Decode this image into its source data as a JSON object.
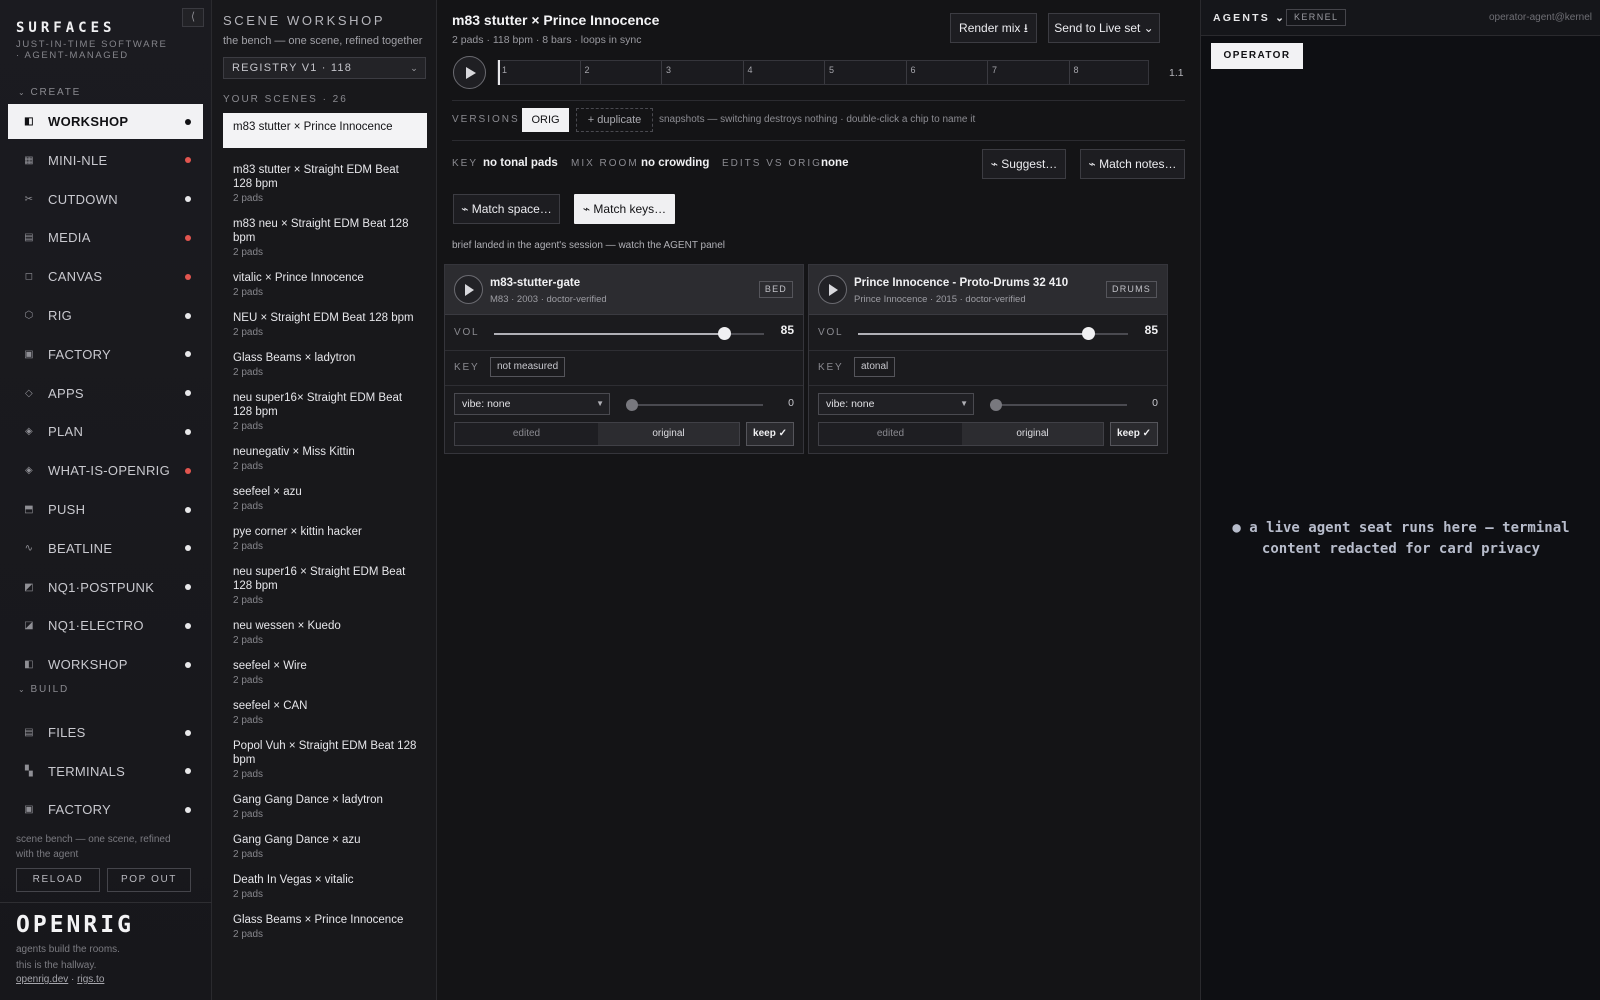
{
  "sidebar": {
    "brand_title": "SURFACES",
    "brand_sub": "JUST-IN-TIME SOFTWARE · AGENT-MANAGED",
    "collapse_glyph": "⟨",
    "create_label": "CREATE",
    "build_label": "BUILD",
    "create_items": [
      {
        "label": "WORKSHOP",
        "icon": "workshop-icon",
        "glyph": "◧",
        "dot": "white",
        "active": true
      },
      {
        "label": "MINI-NLE",
        "icon": "timeline-icon",
        "glyph": "▦",
        "dot": "red"
      },
      {
        "label": "CUTDOWN",
        "icon": "scissors-icon",
        "glyph": "✂",
        "dot": "white"
      },
      {
        "label": "MEDIA",
        "icon": "grid-icon",
        "glyph": "▤",
        "dot": "red"
      },
      {
        "label": "CANVAS",
        "icon": "canvas-icon",
        "glyph": "◻",
        "dot": "red"
      },
      {
        "label": "RIG",
        "icon": "hexagon-icon",
        "glyph": "⬡",
        "dot": "white"
      },
      {
        "label": "FACTORY",
        "icon": "factory-icon",
        "glyph": "▣",
        "dot": "white"
      },
      {
        "label": "APPS",
        "icon": "diamond-icon",
        "glyph": "◇",
        "dot": "white"
      },
      {
        "label": "PLAN",
        "icon": "plan-icon",
        "glyph": "◈",
        "dot": "white"
      },
      {
        "label": "WHAT-IS-OPENRIG",
        "icon": "info-diamond-icon",
        "glyph": "◈",
        "dot": "red"
      },
      {
        "label": "PUSH",
        "icon": "push-icon",
        "glyph": "⬒",
        "dot": "white"
      },
      {
        "label": "BEATLINE",
        "icon": "wave-icon",
        "glyph": "∿",
        "dot": "white"
      },
      {
        "label": "NQ1·POSTPUNK",
        "icon": "postpunk-icon",
        "glyph": "◩",
        "dot": "white"
      },
      {
        "label": "NQ1·ELECTRO",
        "icon": "electro-icon",
        "glyph": "◪",
        "dot": "white"
      },
      {
        "label": "WORKSHOP",
        "icon": "workshop-icon",
        "glyph": "◧",
        "dot": "white"
      }
    ],
    "build_items": [
      {
        "label": "FILES",
        "icon": "files-icon",
        "glyph": "▤",
        "dot": "white"
      },
      {
        "label": "TERMINALS",
        "icon": "terminal-icon",
        "glyph": "▚",
        "dot": "white"
      },
      {
        "label": "FACTORY",
        "icon": "factory-icon",
        "glyph": "▣",
        "dot": "white"
      }
    ],
    "note": "scene bench — one scene, refined with the agent",
    "reload_label": "RELOAD",
    "popout_label": "POP OUT",
    "logo": "OPENRIG",
    "tagline_1": "agents build the rooms.",
    "tagline_2": "this is the hallway.",
    "link_1": "openrig.dev",
    "link_sep": " · ",
    "link_2": "rigs.to"
  },
  "scenes": {
    "title": "SCENE WORKSHOP",
    "subtitle": "the bench — one scene, refined together",
    "registry": "REGISTRY V1 · 118",
    "count_label": "YOUR SCENES · 26",
    "items": [
      {
        "name": "m83 stutter × Prince Innocence",
        "meta": "",
        "active": true
      },
      {
        "name": "m83 stutter × Straight EDM Beat 128 bpm",
        "meta": "2 pads"
      },
      {
        "name": "m83 neu × Straight EDM Beat 128 bpm",
        "meta": "2 pads"
      },
      {
        "name": "vitalic × Prince Innocence",
        "meta": "2 pads"
      },
      {
        "name": "NEU × Straight EDM Beat 128 bpm",
        "meta": "2 pads"
      },
      {
        "name": "Glass Beams × ladytron",
        "meta": "2 pads"
      },
      {
        "name": "neu super16× Straight EDM Beat 128 bpm",
        "meta": "2 pads"
      },
      {
        "name": "neunegativ × Miss Kittin",
        "meta": "2 pads"
      },
      {
        "name": "seefeel × azu",
        "meta": "2 pads"
      },
      {
        "name": "pye corner × kittin hacker",
        "meta": "2 pads"
      },
      {
        "name": "neu super16 × Straight EDM Beat 128 bpm",
        "meta": "2 pads"
      },
      {
        "name": "neu wessen × Kuedo",
        "meta": "2 pads"
      },
      {
        "name": "seefeel × Wire",
        "meta": "2 pads"
      },
      {
        "name": "seefeel × CAN",
        "meta": "2 pads"
      },
      {
        "name": "Popol Vuh × Straight EDM Beat 128 bpm",
        "meta": "2 pads"
      },
      {
        "name": "Gang Gang Dance × ladytron",
        "meta": "2 pads"
      },
      {
        "name": "Gang Gang Dance × azu",
        "meta": "2 pads"
      },
      {
        "name": "Death In Vegas × vitalic",
        "meta": "2 pads"
      },
      {
        "name": "Glass Beams × Prince Innocence",
        "meta": "2 pads"
      }
    ]
  },
  "main": {
    "title": "m83 stutter × Prince Innocence",
    "subtitle": "2 pads · 118 bpm · 8 bars · loops in sync",
    "render_label": "Render mix ⭳",
    "send_label": "Send to Live set ⌄",
    "bars": [
      "1",
      "2",
      "3",
      "4",
      "5",
      "6",
      "7",
      "8"
    ],
    "position": "1.1",
    "versions_label": "VERSIONS",
    "orig_chip": "ORIG",
    "duplicate_label": "+ duplicate",
    "snapshots_note": "snapshots — switching destroys nothing · double-click a chip to name it",
    "key_label": "KEY",
    "key_value": "no tonal pads",
    "mixroom_label": "MIX ROOM",
    "mixroom_value": "no crowding",
    "edits_label": "EDITS VS ORIG",
    "edits_value": "none",
    "suggest_label": "⌁ Suggest…",
    "match_notes_label": "⌁ Match notes…",
    "match_space_label": "⌁ Match space…",
    "match_keys_label": "⌁ Match keys…",
    "brief_note": "brief landed in the agent's session — watch the AGENT panel",
    "pads": [
      {
        "name": "m83-stutter-gate",
        "meta": "M83 · 2003 · doctor-verified",
        "tag": "BED",
        "vol_label": "VOL",
        "volume": 85,
        "volume_text": "85",
        "key_label": "KEY",
        "key_value": "not measured",
        "vibe": "vibe: none",
        "vibe_amount": 0,
        "vibe_text": "0",
        "seg_a": "edited",
        "seg_b": "original",
        "keep_label": "keep ✓"
      },
      {
        "name": "Prince Innocence - Proto-Drums 32 410",
        "meta": "Prince Innocence · 2015 · doctor-verified",
        "tag": "DRUMS",
        "vol_label": "VOL",
        "volume": 85,
        "volume_text": "85",
        "key_label": "KEY",
        "key_value": "atonal",
        "vibe": "vibe: none",
        "vibe_amount": 0,
        "vibe_text": "0",
        "seg_a": "edited",
        "seg_b": "original",
        "keep_label": "keep ✓"
      }
    ]
  },
  "agents": {
    "title": "AGENTS ⌄",
    "kernel": "KERNEL",
    "identity": "operator-agent@kernel",
    "operator_label": "OPERATOR",
    "terminal_note": "● a live agent seat runs here — terminal content redacted for card privacy"
  },
  "colors": {
    "accent_light": "#f2f2f4",
    "status_red": "#e2554f",
    "agent_text": "#b7bccb"
  }
}
